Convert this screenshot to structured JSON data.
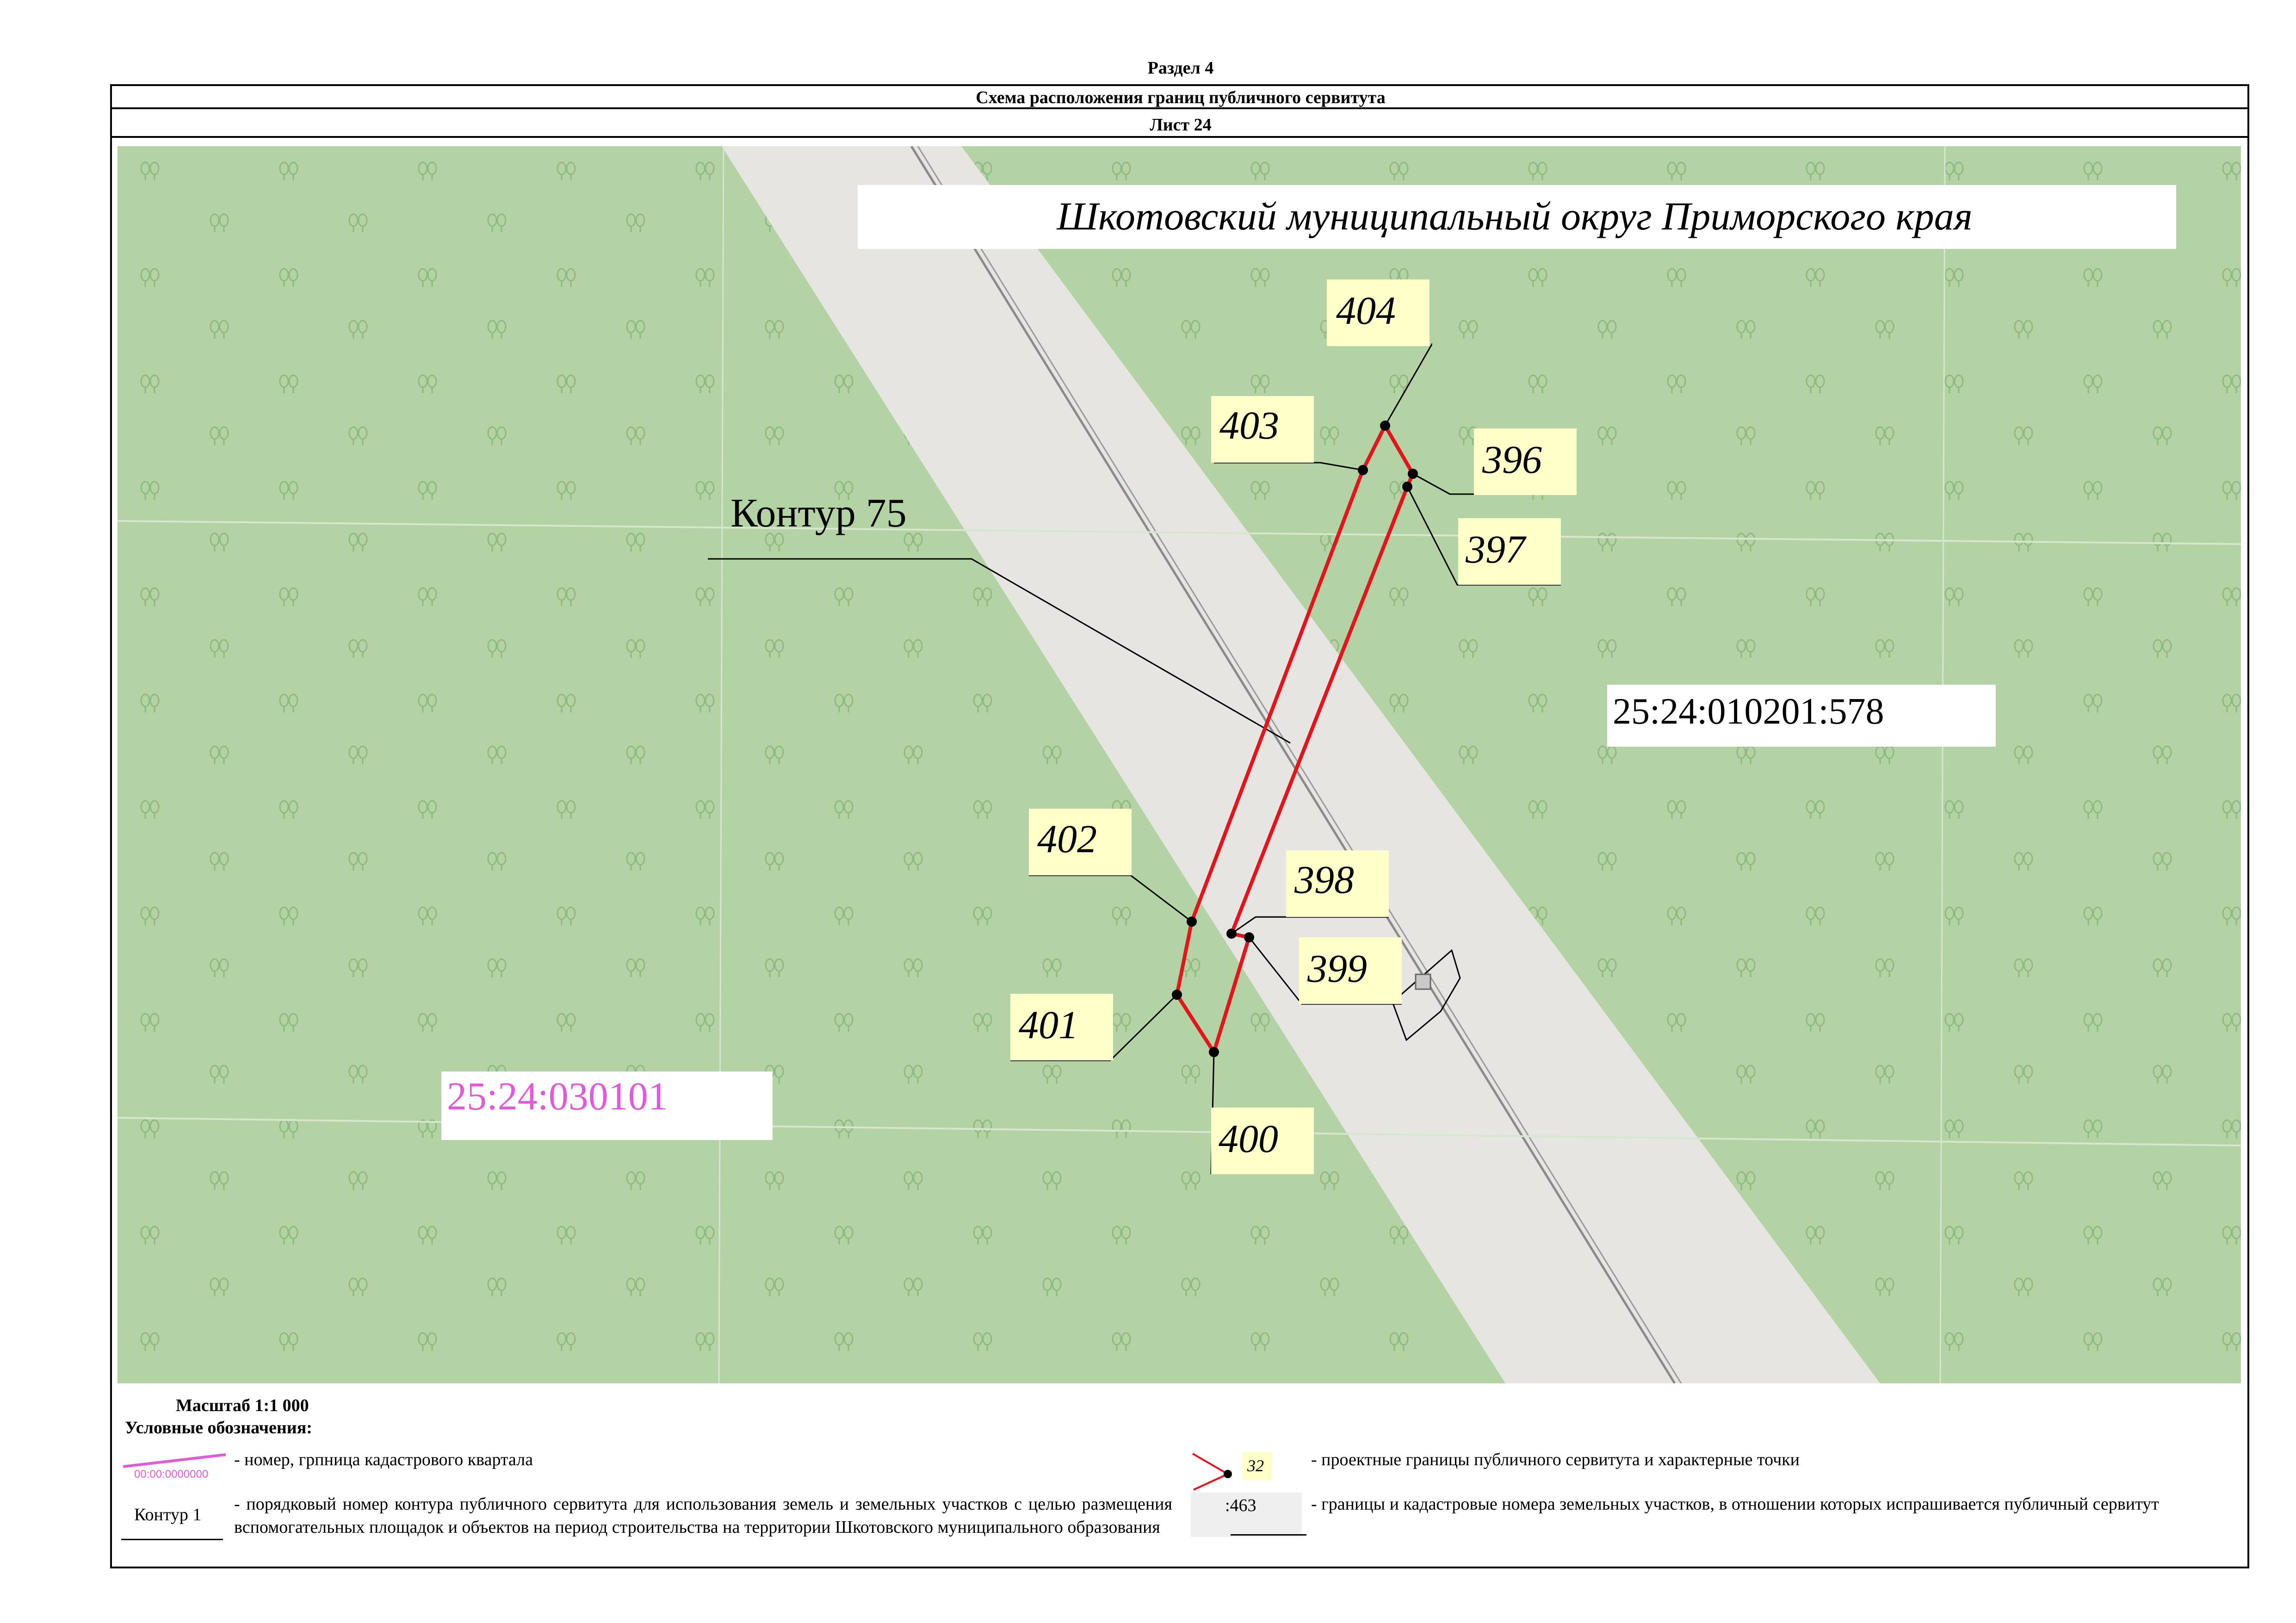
{
  "header": {
    "section": "Раздел 4",
    "title": "Схема расположения границ публичного сервитута",
    "sheet": "Лист 24"
  },
  "map": {
    "district_label": "Шкотовский муниципальный округ Приморского края",
    "contour_label": "Контур 75",
    "parcel_label": "25:24:010201:578",
    "quarter_label": "25:24:030101",
    "points": [
      "404",
      "403",
      "396",
      "397",
      "402",
      "398",
      "399",
      "401",
      "400"
    ],
    "colors": {
      "forest": "#b3d3a5",
      "road": "#e6e5e2",
      "boundary": "#e3141b",
      "quarter_label": "#e05ad9",
      "point_tag": "#ffffc8"
    }
  },
  "footer": {
    "scale": "Масштаб 1:1 000",
    "legend_title": "Условные обозначения:",
    "legend_items": {
      "quarter_sample": "00:00:0000000",
      "quarter_text": "- номер, грпница кадастрового квартала",
      "contour_sample": "Контур 1",
      "contour_text": "- порядковый номер контура публичного сервитута для использования земель и земельных участков с целью размещения вспомогательных площадок и объектов на период строительства на территории Шкотовского муниципального образования",
      "point_sample": "32",
      "point_text": "- проектные границы публичного сервитута и характерные точки",
      "parcel_sample": ":463",
      "parcel_text": "- границы и кадастровые номера земельных участков, в отношении которых испрашивается публичный сервитут"
    }
  }
}
